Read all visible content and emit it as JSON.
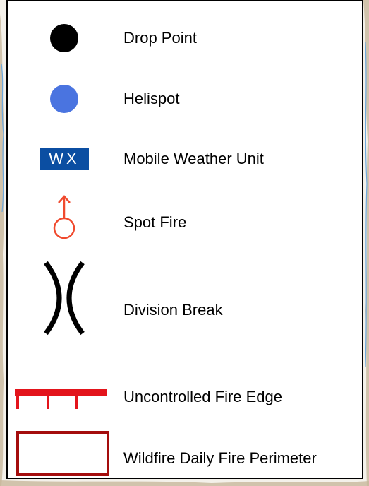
{
  "legend": {
    "items": [
      {
        "id": "drop-point",
        "label": "Drop Point",
        "icon": "black-dot-icon",
        "color": "#000000"
      },
      {
        "id": "helispot",
        "label": "Helispot",
        "icon": "blue-dot-icon",
        "color": "#4a74e0"
      },
      {
        "id": "mobile-weather-unit",
        "label": "Mobile Weather Unit",
        "icon": "wx-box-icon",
        "icon_text": "WX",
        "color": "#0b4ea2"
      },
      {
        "id": "spot-fire",
        "label": "Spot Fire",
        "icon": "spot-fire-icon",
        "color": "#f04a2e"
      },
      {
        "id": "division-break",
        "label": "Division Break",
        "icon": "division-break-icon",
        "color": "#000000"
      },
      {
        "id": "uncontrolled-fire-edge",
        "label": "Uncontrolled Fire Edge",
        "icon": "uncontrolled-edge-icon",
        "color": "#e3141b"
      },
      {
        "id": "wildfire-daily-fire-perimeter",
        "label": "Wildfire Daily Fire Perimeter",
        "icon": "perimeter-rect-icon",
        "color": "#a40d0d"
      }
    ]
  },
  "map_background": {
    "terrain_color": "#c8b89c",
    "water_color": "#6fa9dd"
  }
}
